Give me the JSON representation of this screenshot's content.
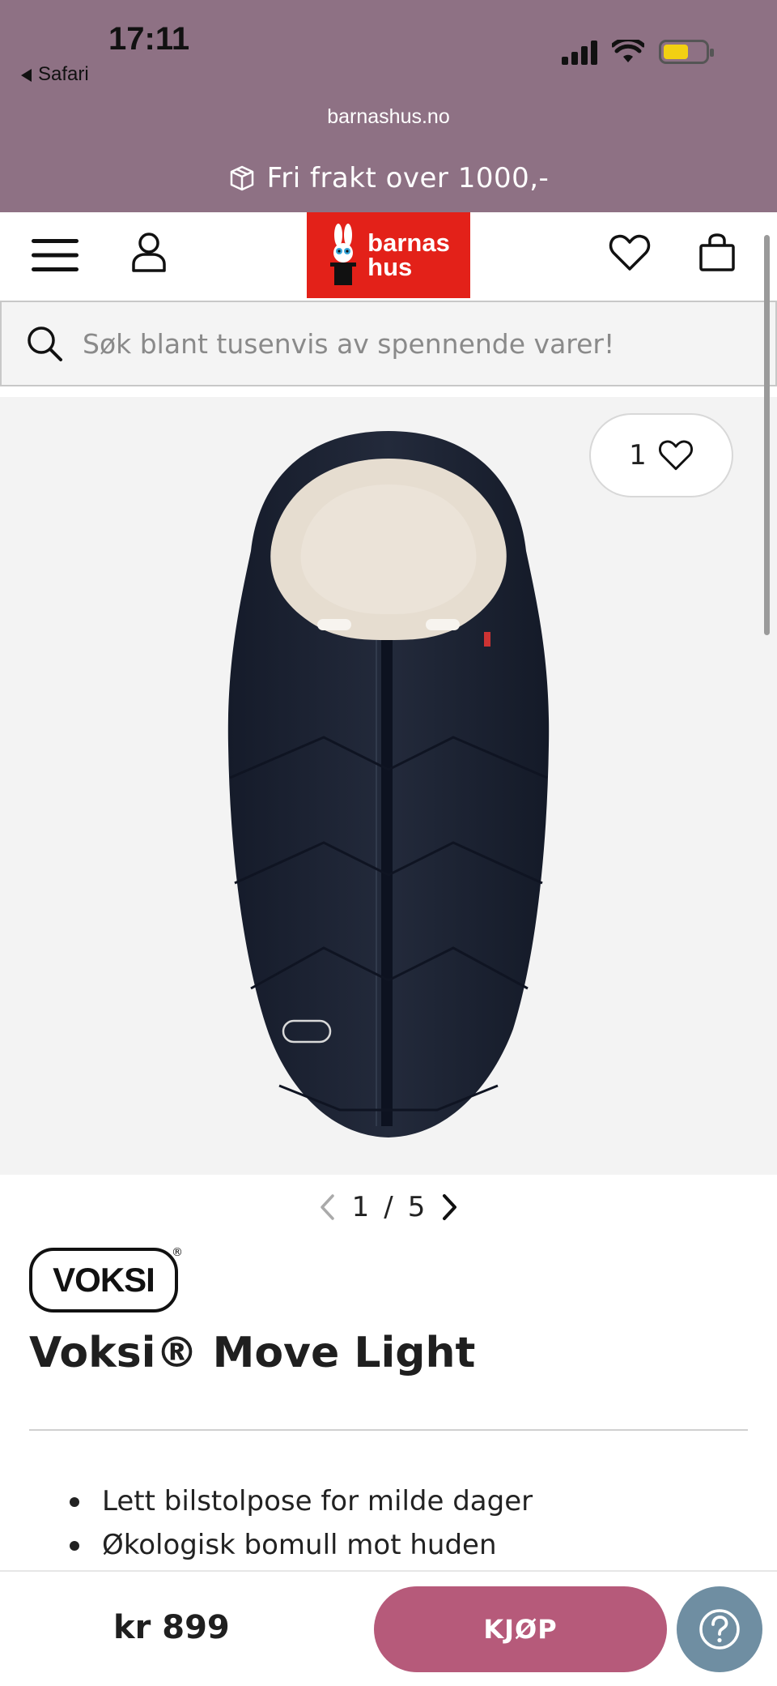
{
  "status_bar": {
    "time": "17:11",
    "back_label": "Safari"
  },
  "browser": {
    "url": "barnashus.no"
  },
  "promo": {
    "text": "Fri frakt over 1000,-"
  },
  "header": {
    "logo_line1": "barnas",
    "logo_line2": "hus",
    "brand_color": "#e32119"
  },
  "search": {
    "placeholder": "Søk blant tusenvis av spennende varer!"
  },
  "gallery": {
    "wishlist_count": "1",
    "current": "1",
    "separator": "/",
    "total": "5"
  },
  "product": {
    "brand_logo_text": "VOKSI",
    "brand_reg": "®",
    "title": "Voksi® Move Light",
    "features": [
      "Lett bilstolpose for milde dager",
      "Økologisk bomull mot huden"
    ]
  },
  "purchase": {
    "price": "kr 899",
    "buy_label": "KJØP",
    "accent_color": "#b65a7a"
  }
}
